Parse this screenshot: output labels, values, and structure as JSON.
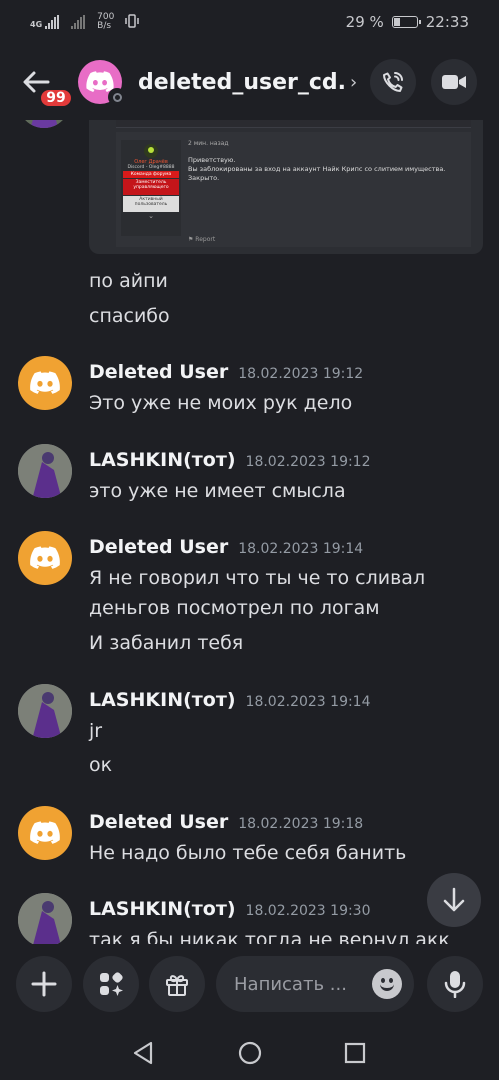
{
  "status_bar": {
    "network_type": "4G",
    "data_rate_value": "700",
    "data_rate_unit": "B/s",
    "battery_percent": "29 %",
    "battery_level": 0.29,
    "time": "22:33"
  },
  "header": {
    "unread_badge": "99",
    "channel_name": "deleted_user_cd...",
    "chevron": "›",
    "call_icon": "phone-call-icon",
    "video_icon": "video-camera-icon"
  },
  "embed": {
    "forum_user_name": "Олег Драчёв",
    "forum_user_discord": "Discord - Oleg#8888",
    "forum_role_1": "Команда форума",
    "forum_role_2": "Заместитель управляющего",
    "forum_role_3": "Активный пользователь",
    "post_time": "2 мин. назад",
    "post_body_1": "Приветствую.",
    "post_body_2": "Вы заблокированы за вход на аккаунт Найк Крипс со слитием имущества.",
    "post_body_3": "Закрыто.",
    "post_report": "Report"
  },
  "messages": [
    {
      "lines": [
        "по айпи",
        "спасибо"
      ]
    },
    {
      "author": "Deleted User",
      "timestamp": "18.02.2023 19:12",
      "lines": [
        "Это уже не моих рук дело"
      ]
    },
    {
      "author": "LASHKIN(тот)",
      "timestamp": "18.02.2023 19:12",
      "lines": [
        "это уже не имеет смысла"
      ]
    },
    {
      "author": "Deleted User",
      "timestamp": "18.02.2023 19:14",
      "lines": [
        "Я не говорил что ты че то сливал",
        "деньгов посмотрел по логам",
        "И забанил тебя"
      ]
    },
    {
      "author": "LASHKIN(тот)",
      "timestamp": "18.02.2023 19:14",
      "lines": [
        "jr",
        "ок"
      ]
    },
    {
      "author": "Deleted User",
      "timestamp": "18.02.2023 19:18",
      "lines": [
        "Не надо было тебе себя банить"
      ]
    },
    {
      "author": "LASHKIN(тот)",
      "timestamp": "18.02.2023 19:30",
      "lines": [
        "так я бы никак тогда не вернул акк"
      ]
    }
  ],
  "input": {
    "placeholder": "Написать ...",
    "add_icon": "plus-icon",
    "apps_icon": "apps-icon",
    "gift_icon": "gift-icon",
    "emoji_icon": "emoji-icon",
    "mic_icon": "microphone-icon"
  },
  "colors": {
    "background": "#1e1f24",
    "discord_avatar": "#f0a232",
    "header_avatar": "#e86dc6",
    "badge": "#e23a3a"
  }
}
